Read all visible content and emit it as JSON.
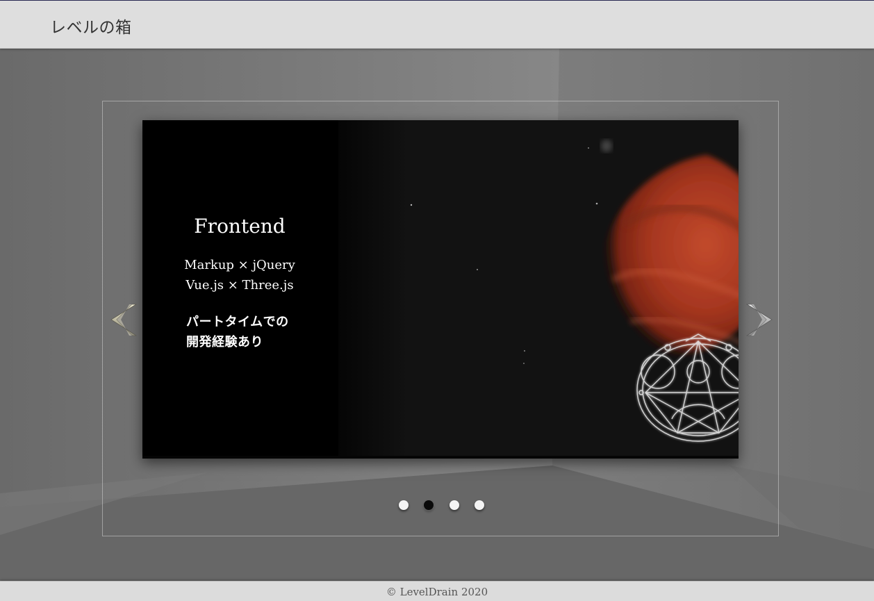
{
  "header": {
    "site_title": "レベルの箱"
  },
  "carousel": {
    "active_index": 1,
    "slide_count": 4,
    "prev_icon": "chevron-left-icon",
    "next_icon": "chevron-right-icon",
    "slide": {
      "heading": "Frontend",
      "skills": [
        "Markup × jQuery",
        "Vue.js × Three.js"
      ],
      "experience": [
        "パートタイムでの",
        "開発経験あり"
      ],
      "artwork": "red-planet-with-magic-circle"
    }
  },
  "footer": {
    "copyright": "© LevelDrain 2020"
  },
  "colors": {
    "header_bg": "#dedede",
    "room_bg": "#777777",
    "slide_bg": "#121212",
    "planet": "#b33a22",
    "dot_inactive": "#f4f4f4",
    "dot_active": "#0a0a0a"
  }
}
